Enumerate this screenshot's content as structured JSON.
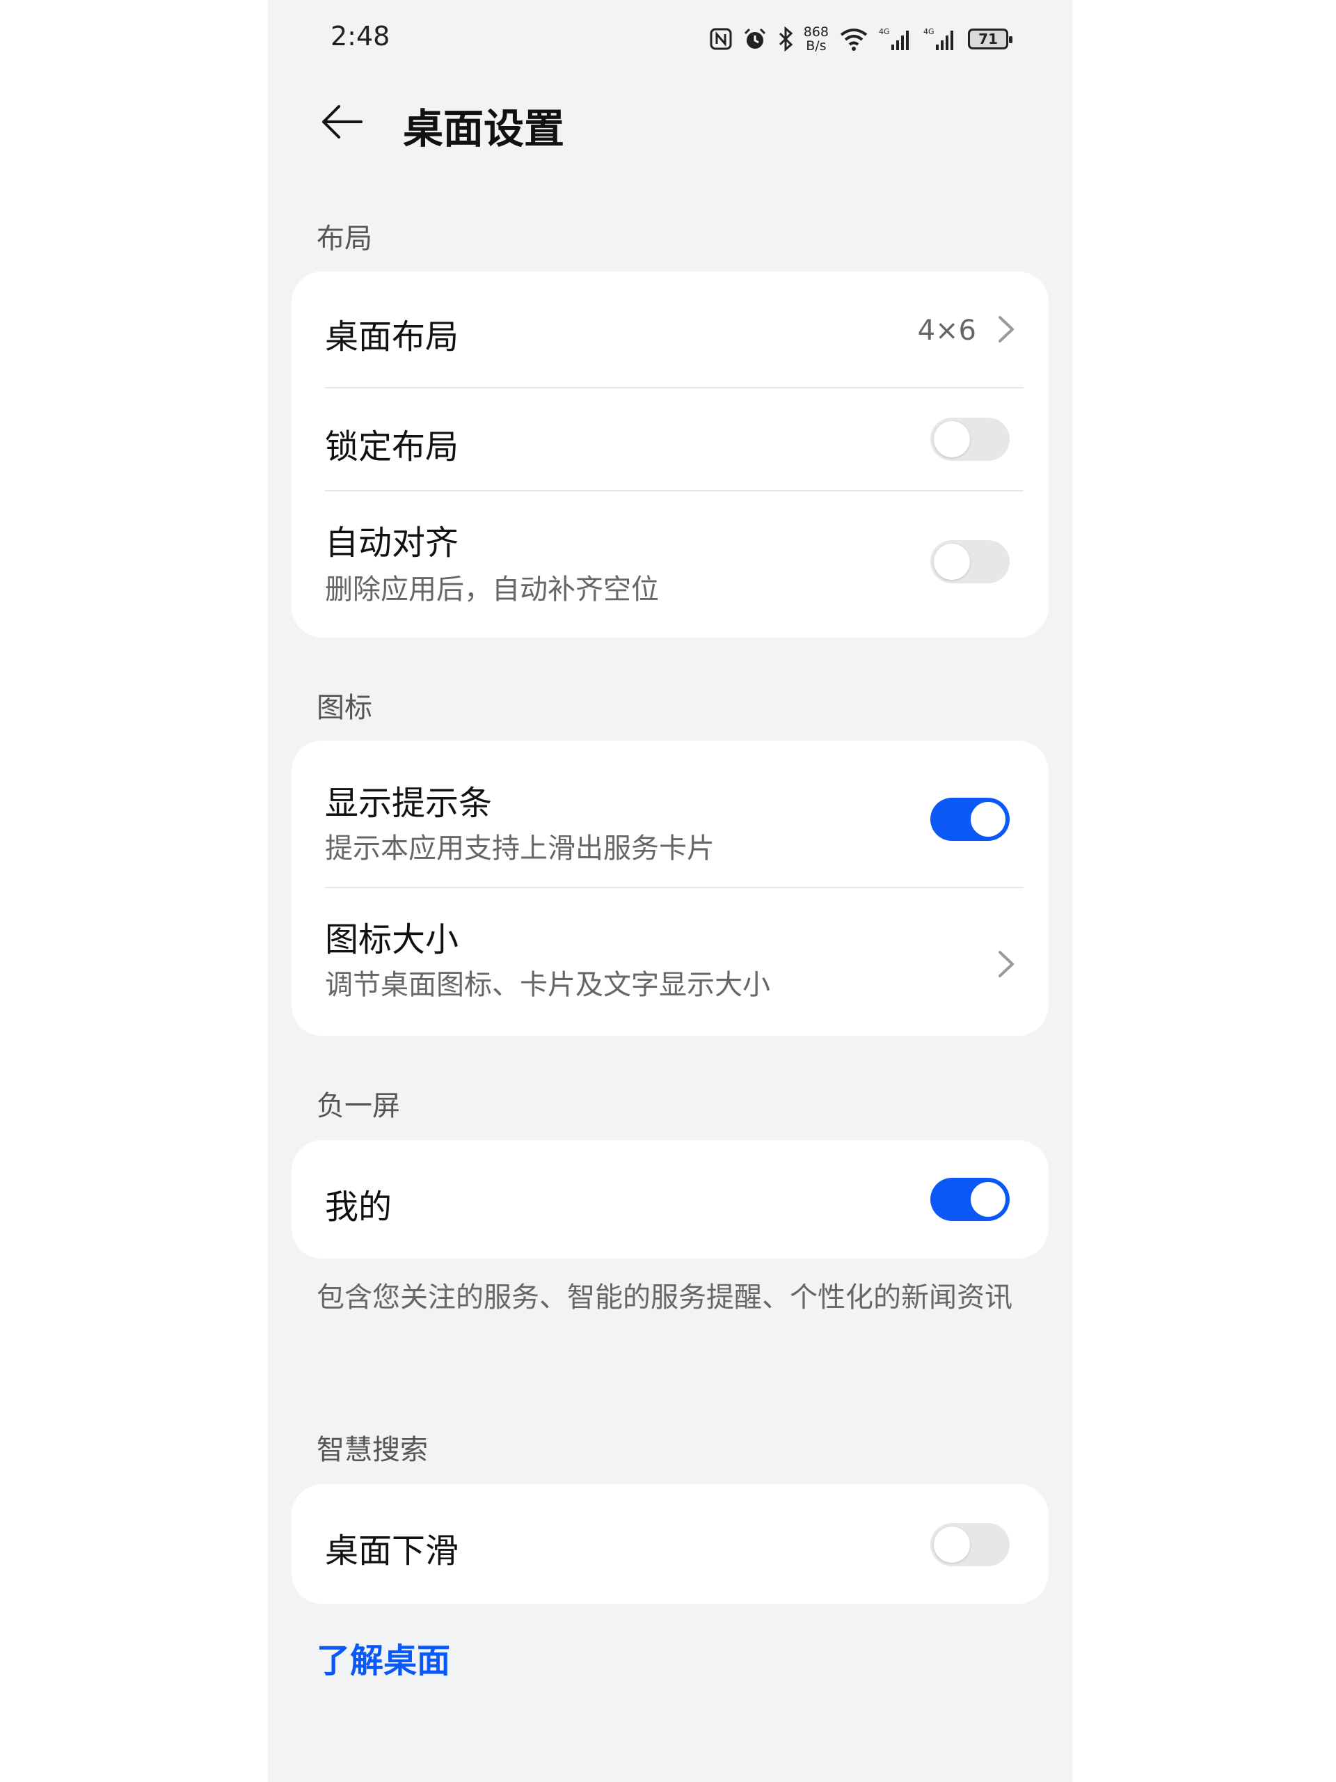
{
  "status_bar": {
    "time": "2:48",
    "net_speed_value": "868",
    "net_speed_unit": "B/s",
    "net_type_1": "4G",
    "net_type_2": "4G",
    "battery": "71"
  },
  "header": {
    "title": "桌面设置"
  },
  "sections": {
    "layout": {
      "label": "布局",
      "desktop_layout": {
        "title": "桌面布局",
        "value": "4×6"
      },
      "lock_layout": {
        "title": "锁定布局",
        "enabled": false
      },
      "auto_align": {
        "title": "自动对齐",
        "subtitle": "删除应用后，自动补齐空位",
        "enabled": false
      }
    },
    "icons": {
      "label": "图标",
      "show_hint_bar": {
        "title": "显示提示条",
        "subtitle": "提示本应用支持上滑出服务卡片",
        "enabled": true
      },
      "icon_size": {
        "title": "图标大小",
        "subtitle": "调节桌面图标、卡片及文字显示大小"
      }
    },
    "minus_one_screen": {
      "label": "负一屏",
      "mine": {
        "title": "我的",
        "enabled": true
      },
      "footnote": "包含您关注的服务、智能的服务提醒、个性化的新闻资讯"
    },
    "smart_search": {
      "label": "智慧搜索",
      "desktop_swipe_down": {
        "title": "桌面下滑",
        "enabled": false
      }
    }
  },
  "links": {
    "learn_desktop": "了解桌面"
  },
  "colors": {
    "accent": "#0a59f7",
    "background": "#f1f3f5",
    "card": "#ffffff"
  }
}
